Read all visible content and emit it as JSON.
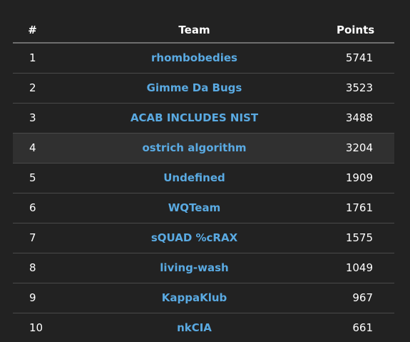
{
  "scoreboard": {
    "headers": {
      "rank": "#",
      "team": "Team",
      "points": "Points"
    },
    "rows": [
      {
        "rank": "1",
        "team": "rhombobedies",
        "points": "5741"
      },
      {
        "rank": "2",
        "team": "Gimme Da Bugs",
        "points": "3523"
      },
      {
        "rank": "3",
        "team": "ACAB INCLUDES NIST",
        "points": "3488"
      },
      {
        "rank": "4",
        "team": "ostrich algorithm",
        "points": "3204"
      },
      {
        "rank": "5",
        "team": "Undefined",
        "points": "1909"
      },
      {
        "rank": "6",
        "team": "WQTeam",
        "points": "1761"
      },
      {
        "rank": "7",
        "team": "sQUAD %cRAX",
        "points": "1575"
      },
      {
        "rank": "8",
        "team": "living-wash",
        "points": "1049"
      },
      {
        "rank": "9",
        "team": "KappaKlub",
        "points": "967"
      },
      {
        "rank": "10",
        "team": "nkCIA",
        "points": "661"
      }
    ]
  },
  "colors": {
    "background": "#222222",
    "team_link": "#5aaae2",
    "row_hover": "#303030"
  }
}
